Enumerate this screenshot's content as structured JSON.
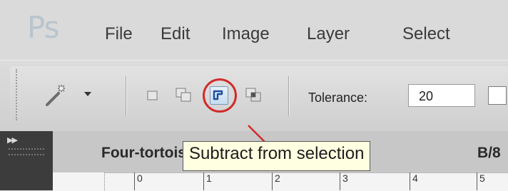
{
  "app": {
    "logo": "Ps"
  },
  "menu": {
    "items": [
      "File",
      "Edit",
      "Image",
      "Layer",
      "Select"
    ]
  },
  "options": {
    "tool": "magic-wand-icon",
    "selection_modes": [
      "new-selection-icon",
      "add-to-selection-icon",
      "subtract-from-selection-icon",
      "intersect-with-selection-icon"
    ],
    "active_mode": "subtract-from-selection-icon",
    "tolerance_label": "Tolerance:",
    "tolerance_value": "20"
  },
  "document": {
    "tab_title": "Four-tortoise",
    "tab_suffix": "B/8",
    "ruler_numbers": [
      "0",
      "1",
      "2",
      "3",
      "4",
      "5"
    ]
  },
  "tooltip": {
    "text": "Subtract from selection"
  },
  "colors": {
    "highlight": "#d02b2b",
    "tooltip_bg": "#ffffe1",
    "active_button": "#c6dcf2"
  }
}
